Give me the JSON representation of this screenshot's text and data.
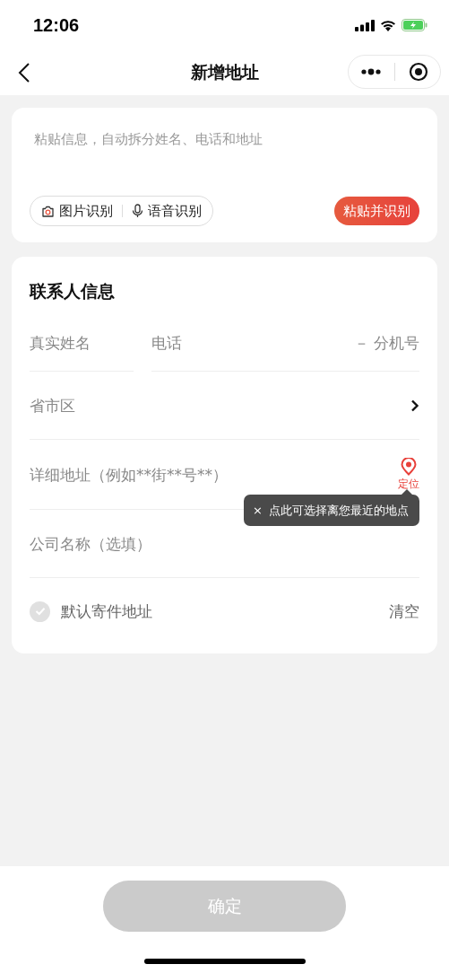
{
  "status_bar": {
    "time": "12:06"
  },
  "nav": {
    "title": "新增地址"
  },
  "paste_card": {
    "placeholder": "粘贴信息，自动拆分姓名、电话和地址",
    "image_button": "图片识别",
    "voice_button": "语音识别",
    "paste_button": "粘贴并识别"
  },
  "contact_card": {
    "title": "联系人信息",
    "name_field": {
      "placeholder": "真实姓名"
    },
    "phone_field": {
      "placeholder": "电话"
    },
    "extension_field": {
      "placeholder": "－ 分机号"
    },
    "region_field": {
      "placeholder": "省市区"
    },
    "detail_field": {
      "placeholder": "详细地址（例如**街**号**）"
    },
    "locate_button": "定位",
    "tooltip": {
      "close": "×",
      "text": "点此可选择离您最近的地点"
    },
    "company_field": {
      "placeholder": "公司名称（选填）"
    },
    "default_address": {
      "label": "默认寄件地址",
      "checked": false
    },
    "clear_button": "清空"
  },
  "confirm_button": {
    "label": "确定",
    "disabled": true
  }
}
